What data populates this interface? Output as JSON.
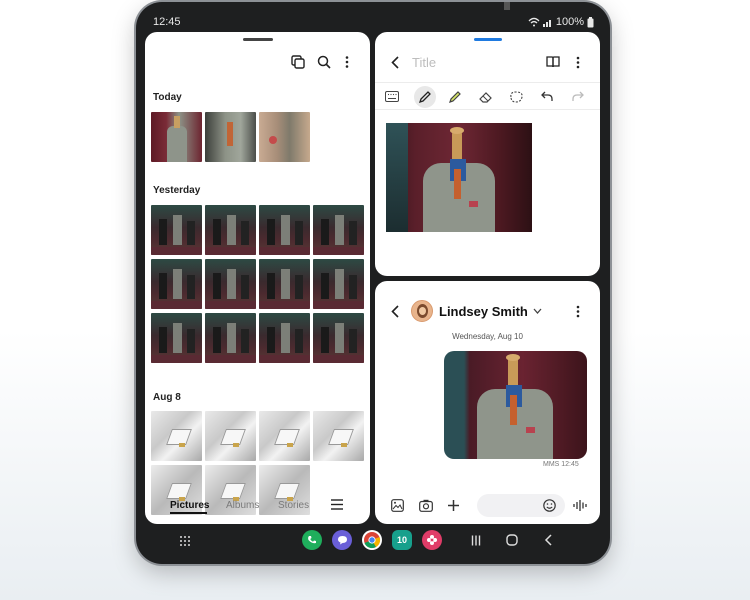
{
  "status": {
    "time": "12:45",
    "battery": "100%"
  },
  "gallery": {
    "sections": [
      {
        "title": "Today"
      },
      {
        "title": "Yesterday"
      },
      {
        "title": "Aug 8"
      }
    ],
    "tabs": [
      {
        "label": "Pictures",
        "active": true
      },
      {
        "label": "Albums",
        "active": false
      },
      {
        "label": "Stories",
        "active": false
      }
    ]
  },
  "notes": {
    "title_placeholder": "Title",
    "accent": "#1f7ae0"
  },
  "messages": {
    "contact_name": "Lindsey Smith",
    "date_label": "Wednesday, Aug 10",
    "message_meta": "MMS 12:45"
  },
  "dock": {
    "apps": [
      {
        "icon": "phone-app-icon",
        "color": "#1fae5c",
        "glyph": "✆"
      },
      {
        "icon": "messages-app-icon",
        "color": "#6a5fd8",
        "glyph": "💬"
      },
      {
        "icon": "chrome-app-icon",
        "color": "#ffffff",
        "glyph": ""
      },
      {
        "icon": "calendar-app-icon",
        "color": "#17a08c",
        "glyph": "10"
      },
      {
        "icon": "bixby-flower-app-icon",
        "color": "#e03c68",
        "glyph": "✿"
      }
    ]
  }
}
